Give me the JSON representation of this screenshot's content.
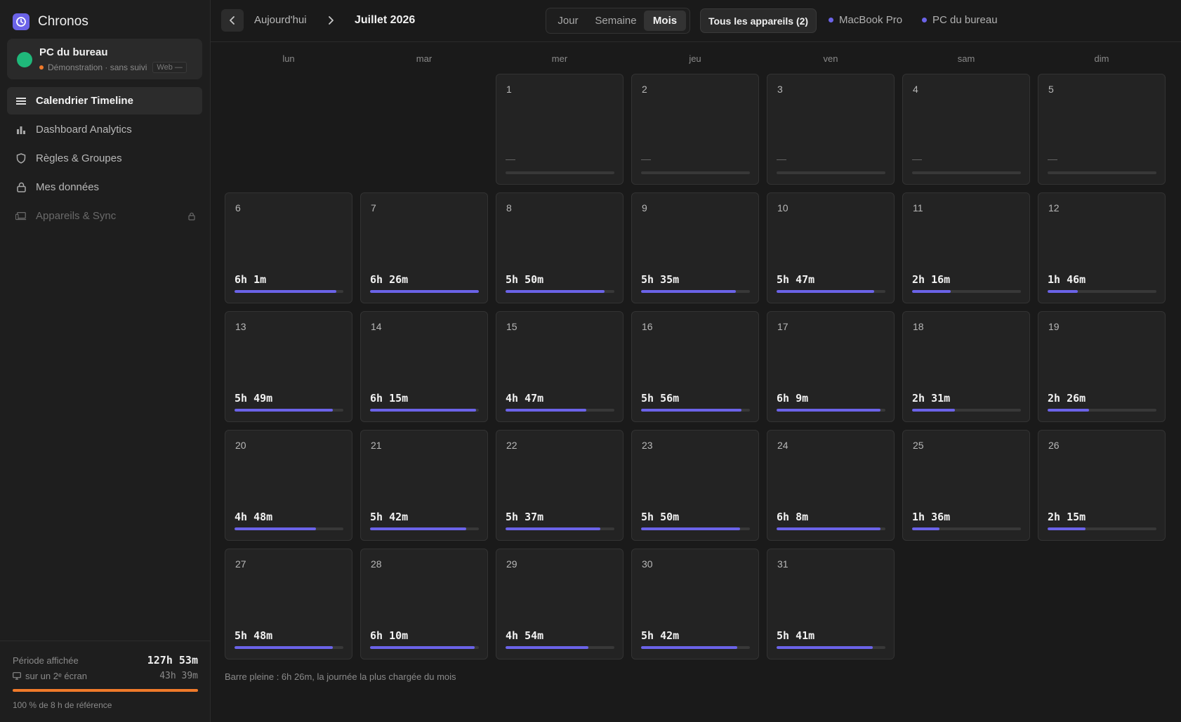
{
  "app": {
    "name": "Chronos",
    "accent": "#6b63e8"
  },
  "device": {
    "name": "PC du bureau",
    "status": "Démonstration · sans suivi",
    "badge": "Web —",
    "status_color": "#1fb87a"
  },
  "nav": {
    "items": [
      {
        "label": "Calendrier Timeline",
        "icon": "timeline-icon",
        "active": true
      },
      {
        "label": "Dashboard Analytics",
        "icon": "bar-chart-icon",
        "active": false
      },
      {
        "label": "Règles & Groupes",
        "icon": "shield-icon",
        "active": false
      },
      {
        "label": "Mes données",
        "icon": "lock-icon",
        "active": false
      },
      {
        "label": "Appareils & Sync",
        "icon": "devices-icon",
        "active": false,
        "locked": true
      }
    ]
  },
  "footer": {
    "period_label": "Période affichée",
    "period_total": "127h 53m",
    "second_screen_label": "sur un 2ᵉ écran",
    "second_screen_value": "43h 39m",
    "reference_progress": 1.0,
    "reference_note": "100 % de 8 h de référence"
  },
  "header": {
    "today_label": "Aujourd'hui",
    "month_title": "Juillet 2026",
    "views": {
      "day": "Jour",
      "week": "Semaine",
      "month": "Mois"
    },
    "active_view": "month",
    "all_devices": "Tous les appareils (2)",
    "device_filters": [
      "MacBook Pro",
      "PC du bureau"
    ]
  },
  "calendar": {
    "weekdays": [
      "lun",
      "mar",
      "mer",
      "jeu",
      "ven",
      "sam",
      "dim"
    ],
    "first_weekday_index": 2,
    "empty_placeholder": "—",
    "max_minutes": 386,
    "days": [
      {
        "day": "1",
        "duration": null,
        "minutes": 0
      },
      {
        "day": "2",
        "duration": null,
        "minutes": 0
      },
      {
        "day": "3",
        "duration": null,
        "minutes": 0
      },
      {
        "day": "4",
        "duration": null,
        "minutes": 0
      },
      {
        "day": "5",
        "duration": null,
        "minutes": 0
      },
      {
        "day": "6",
        "duration": "6h 1m",
        "minutes": 361
      },
      {
        "day": "7",
        "duration": "6h 26m",
        "minutes": 386
      },
      {
        "day": "8",
        "duration": "5h 50m",
        "minutes": 350
      },
      {
        "day": "9",
        "duration": "5h 35m",
        "minutes": 335
      },
      {
        "day": "10",
        "duration": "5h 47m",
        "minutes": 347
      },
      {
        "day": "11",
        "duration": "2h 16m",
        "minutes": 136
      },
      {
        "day": "12",
        "duration": "1h 46m",
        "minutes": 106
      },
      {
        "day": "13",
        "duration": "5h 49m",
        "minutes": 349
      },
      {
        "day": "14",
        "duration": "6h 15m",
        "minutes": 375
      },
      {
        "day": "15",
        "duration": "4h 47m",
        "minutes": 287
      },
      {
        "day": "16",
        "duration": "5h 56m",
        "minutes": 356
      },
      {
        "day": "17",
        "duration": "6h 9m",
        "minutes": 369
      },
      {
        "day": "18",
        "duration": "2h 31m",
        "minutes": 151
      },
      {
        "day": "19",
        "duration": "2h 26m",
        "minutes": 146
      },
      {
        "day": "20",
        "duration": "4h 48m",
        "minutes": 288
      },
      {
        "day": "21",
        "duration": "5h 42m",
        "minutes": 342
      },
      {
        "day": "22",
        "duration": "5h 37m",
        "minutes": 337
      },
      {
        "day": "23",
        "duration": "5h 50m",
        "minutes": 350
      },
      {
        "day": "24",
        "duration": "6h 8m",
        "minutes": 368
      },
      {
        "day": "25",
        "duration": "1h 36m",
        "minutes": 96
      },
      {
        "day": "26",
        "duration": "2h 15m",
        "minutes": 135
      },
      {
        "day": "27",
        "duration": "5h 48m",
        "minutes": 348
      },
      {
        "day": "28",
        "duration": "6h 10m",
        "minutes": 370
      },
      {
        "day": "29",
        "duration": "4h 54m",
        "minutes": 294
      },
      {
        "day": "30",
        "duration": "5h 42m",
        "minutes": 342
      },
      {
        "day": "31",
        "duration": "5h 41m",
        "minutes": 341
      }
    ]
  },
  "legend_note": "Barre pleine : 6h 26m, la journée la plus chargée du mois"
}
